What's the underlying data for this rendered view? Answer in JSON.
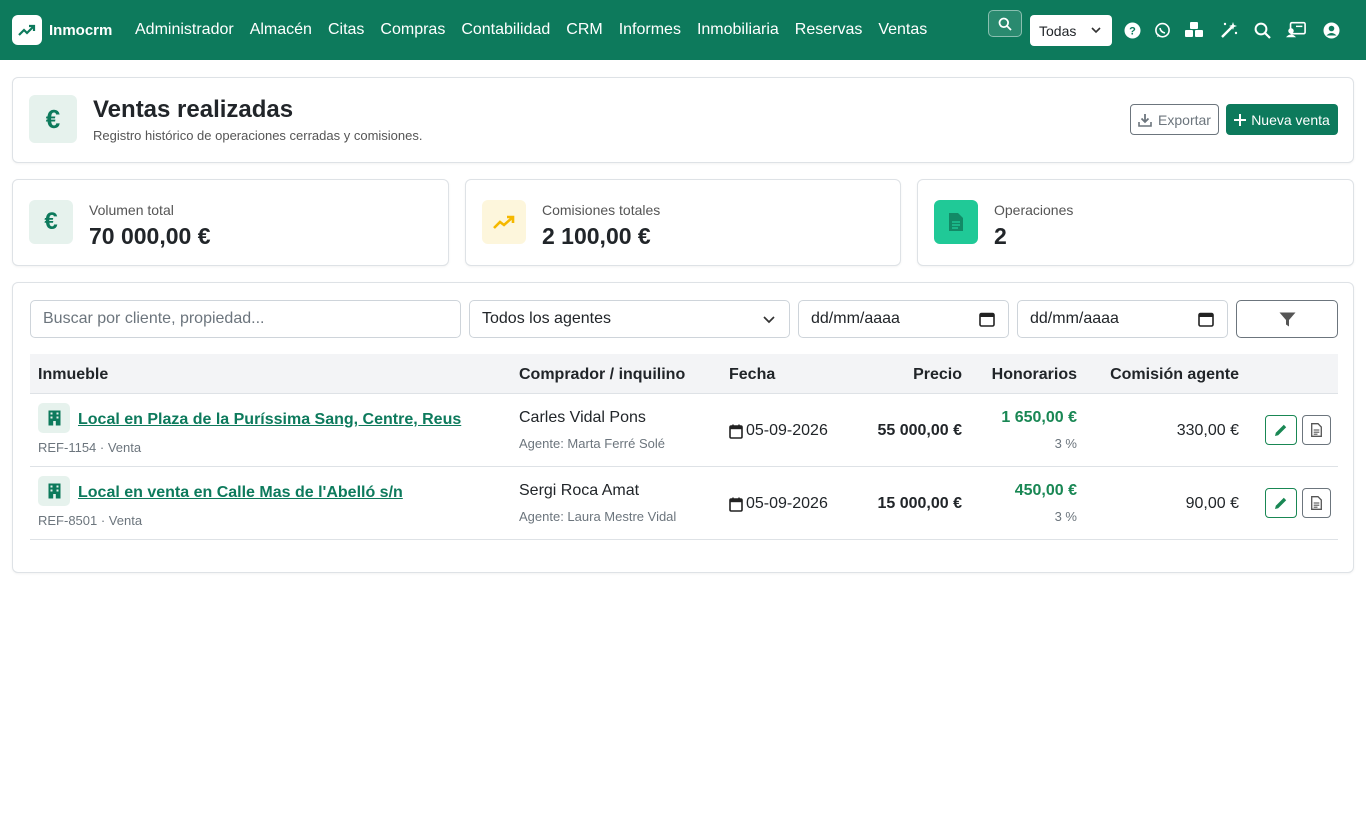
{
  "brand": {
    "name": "Inmocrm",
    "icon": "trending-up-icon"
  },
  "nav": {
    "links": [
      "Administrador",
      "Almacén",
      "Citas",
      "Compras",
      "Contabilidad",
      "CRM",
      "Informes",
      "Inmobiliaria",
      "Reservas",
      "Ventas"
    ],
    "scope_select": "Todas",
    "icons": [
      "search-icon",
      "help-icon",
      "whatsapp-icon",
      "boxes-icon",
      "magic-wand-icon",
      "search-icon",
      "id-card-icon",
      "user-icon"
    ]
  },
  "header": {
    "icon": "euro-icon",
    "icon_glyph": "€",
    "title": "Ventas realizadas",
    "subtitle": "Registro histórico de operaciones cerradas y comisiones.",
    "export_label": "Exportar",
    "new_label": "Nueva venta"
  },
  "stats": [
    {
      "label": "Volumen total",
      "value": "70 000,00 €",
      "icon": "euro-icon",
      "glyph": "€"
    },
    {
      "label": "Comisiones totales",
      "value": "2 100,00 €",
      "icon": "trending-up-icon"
    },
    {
      "label": "Operaciones",
      "value": "2",
      "icon": "document-icon"
    }
  ],
  "filters": {
    "search_placeholder": "Buscar por cliente, propiedad...",
    "agent_select": "Todos los agentes",
    "date_from_placeholder": "dd/mm/aaaa",
    "date_to_placeholder": "dd/mm/aaaa"
  },
  "table": {
    "headers": [
      "Inmueble",
      "Comprador / inquilino",
      "Fecha",
      "Precio",
      "Honorarios",
      "Comisión agente"
    ],
    "rows": [
      {
        "property": "Local en Plaza de la Puríssima Sang, Centre, Reus",
        "ref": "REF-1154 · Venta",
        "buyer": "Carles Vidal Pons",
        "agent": "Agente: Marta Ferré Solé",
        "date": "05-09-2026",
        "price": "55 000,00 €",
        "fee": "1 650,00 €",
        "fee_pct": "3 %",
        "commission": "330,00 €"
      },
      {
        "property": "Local en venta en Calle Mas de l'Abelló s/n",
        "ref": "REF-8501 · Venta",
        "buyer": "Sergi Roca Amat",
        "agent": "Agente: Laura Mestre Vidal",
        "date": "05-09-2026",
        "price": "15 000,00 €",
        "fee": "450,00 €",
        "fee_pct": "3 %",
        "commission": "90,00 €"
      }
    ]
  },
  "colors": {
    "primary": "#0d7a5c",
    "success": "#198754",
    "warning": "#f5c518",
    "teal": "#20c997"
  }
}
